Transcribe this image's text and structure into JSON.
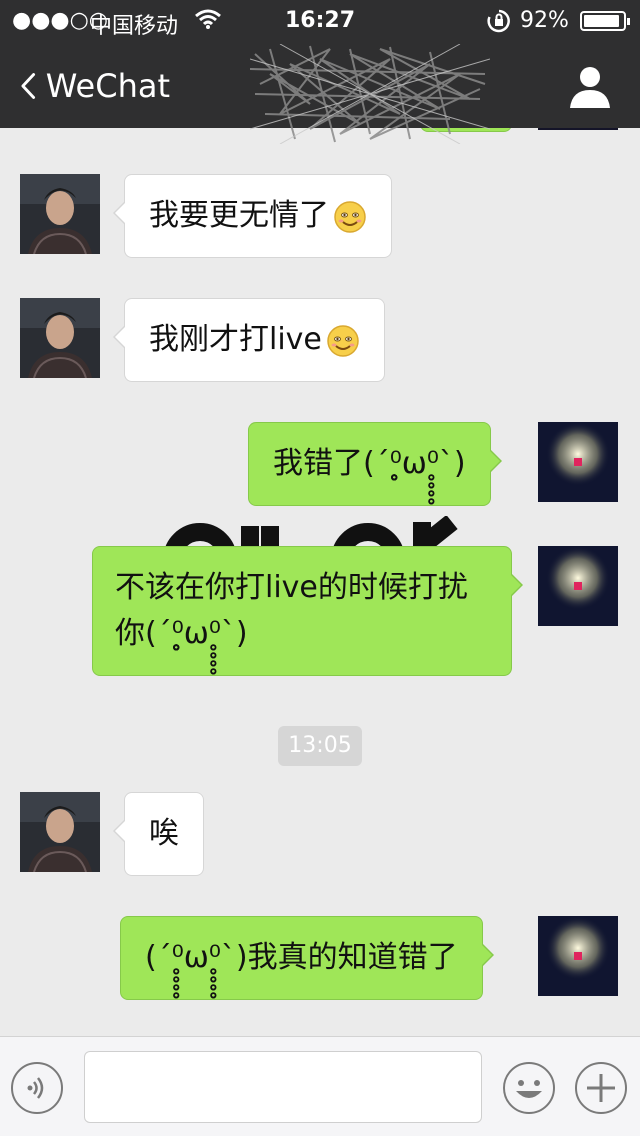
{
  "status_bar": {
    "signal": "●●●○○",
    "carrier": "中国移动",
    "time": "16:27",
    "battery_percent": "92%",
    "battery_level": 0.92
  },
  "nav": {
    "back_label": "WeChat"
  },
  "messages": [
    {
      "side": "left",
      "text": "我要更无情了",
      "emoji": "smile-emoji"
    },
    {
      "side": "left",
      "text": "我刚才打live",
      "emoji": "smile-emoji"
    },
    {
      "side": "right",
      "text": "我错了(´⁰̥̥̥̥ω⁰̥̥̥̥`)"
    },
    {
      "side": "right",
      "text_line1": "不该在你打live的时候打扰",
      "text_line2": "你(´⁰̥̥̥̥ω⁰̥̥̥̥`)"
    },
    {
      "side": "left",
      "text": "唉"
    },
    {
      "side": "right",
      "text": "(´⁰̥̥̥̥ω⁰̥̥̥̥`)我真的知道错了"
    }
  ],
  "timestamp": "13:05",
  "colors": {
    "nav_bg": "#2f2f30",
    "chat_bg": "#ebebeb",
    "bubble_sent": "#9fe658",
    "bubble_received": "#ffffff"
  }
}
